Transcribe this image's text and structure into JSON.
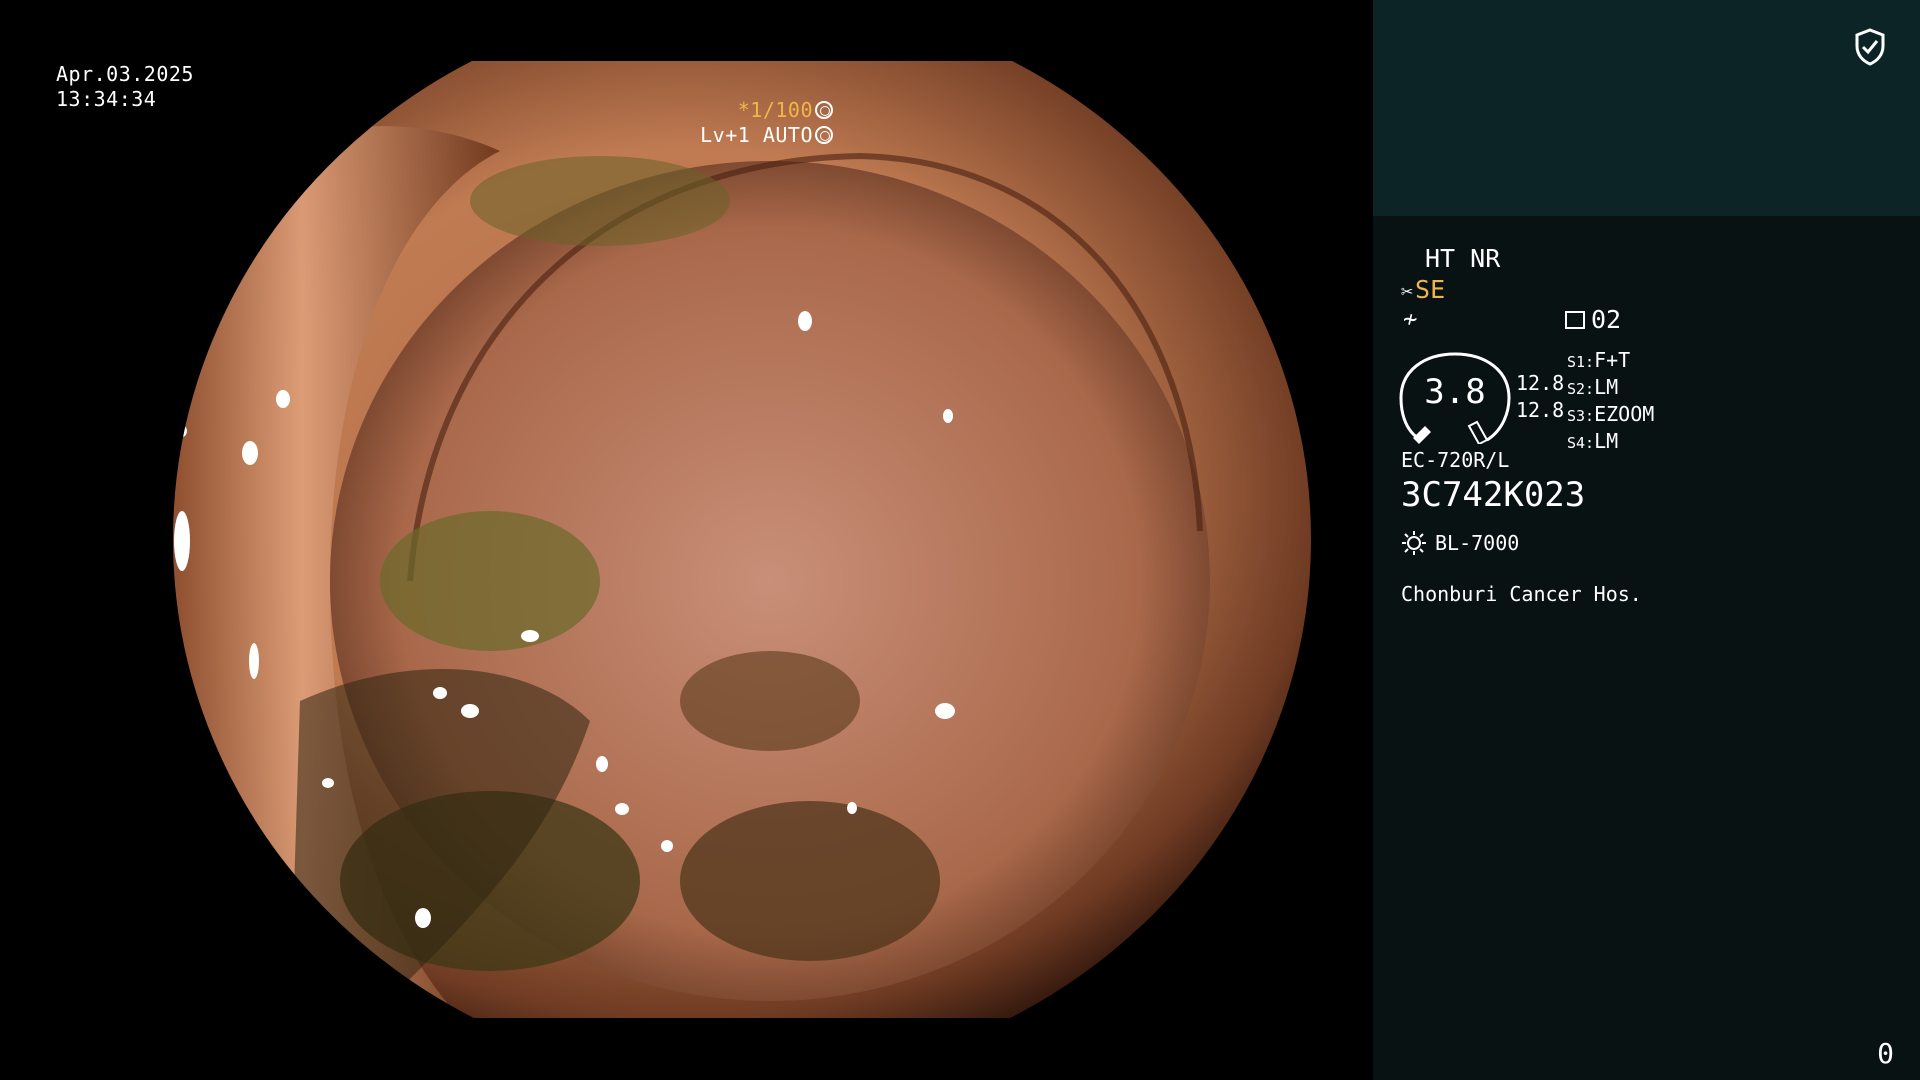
{
  "osd": {
    "date": "Apr.03.2025",
    "time": "13:34:34",
    "shutter": "*1/100",
    "level": "Lv+1 AUTO"
  },
  "panel": {
    "mode": "HT NR",
    "se": "SE",
    "page": "02",
    "zoom_dial": "3.8",
    "zoom_values": [
      "12.8",
      "12.8"
    ],
    "slots": [
      {
        "key": "S1:",
        "value": "F+T"
      },
      {
        "key": "S2:",
        "value": "LM"
      },
      {
        "key": "S3:",
        "value": "EZOOM"
      },
      {
        "key": "S4:",
        "value": "LM"
      }
    ],
    "scope_model": "EC-720R/L",
    "serial": "3C742K023",
    "light_source": "BL-7000",
    "hospital": "Chonburi Cancer Hos.",
    "counter": "0"
  },
  "icons": [
    "shield-check-icon",
    "scissors-icon",
    "curve-icon",
    "page-icon",
    "sun-icon",
    "aperture-icon"
  ],
  "colors": {
    "accent": "#f0b64a",
    "panel_top": "#0c2426",
    "panel_bg": "#081212"
  }
}
